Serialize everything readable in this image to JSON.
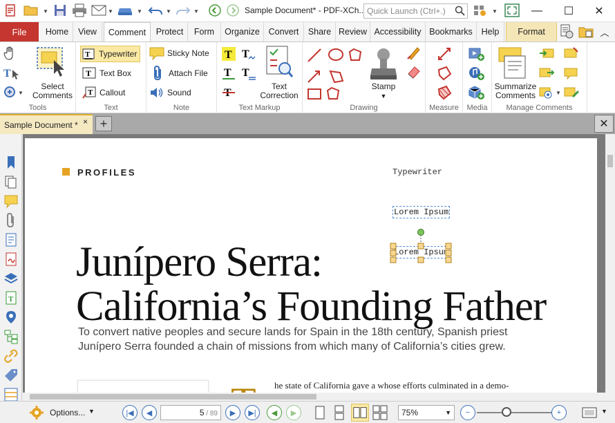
{
  "window": {
    "title": "Sample Document* - PDF-XCh..",
    "quick_launch_placeholder": "Quick Launch (Ctrl+.)",
    "minimize": "—",
    "maximize": "☐",
    "close": "✕"
  },
  "tabs": {
    "file": "File",
    "items": [
      "Home",
      "View",
      "Comment",
      "Protect",
      "Form",
      "Organize",
      "Convert",
      "Share",
      "Review",
      "Accessibility",
      "Bookmarks",
      "Help",
      "Format"
    ],
    "active": "Comment"
  },
  "ribbon": {
    "tools": {
      "label": "Tools",
      "select_comments": "Select\nComments"
    },
    "text": {
      "label": "Text",
      "typewriter": "Typewriter",
      "text_box": "Text Box",
      "callout": "Callout"
    },
    "note": {
      "label": "Note",
      "sticky_note": "Sticky Note",
      "attach_file": "Attach File",
      "sound": "Sound"
    },
    "text_markup": {
      "label": "Text Markup",
      "text_correction": "Text\nCorrection"
    },
    "drawing": {
      "label": "Drawing",
      "stamp": "Stamp"
    },
    "measure": {
      "label": "Measure"
    },
    "media": {
      "label": "Media"
    },
    "manage": {
      "label": "Manage Comments",
      "summarize": "Summarize\nComments"
    }
  },
  "doc_tab": {
    "name": "Sample Document *",
    "close": "×",
    "new": "+"
  },
  "document": {
    "section": "PROFILES",
    "typewriter_label": "Typewriter",
    "lorem1": "Lorem Ipsum",
    "lorem2": "Lorem Ipsum",
    "headline_line1": "Junípero Serra:",
    "headline_line2": "California’s Founding Father",
    "subhead": "To convert native peoples and secure lands for Spain in the 18th century, Spanish priest Junípero Serra founded a chain of missions from which many of California’s cities grew.",
    "dropcap": "T",
    "body_start": "he state of California gave a    whose efforts culminated in a demo-"
  },
  "statusbar": {
    "options": "Options...",
    "page_current": "5",
    "page_total": "89",
    "zoom": "75%"
  },
  "colors": {
    "file_tab": "#c4362f",
    "accent_gold": "#e6a323",
    "format_tab": "#f5e6b8",
    "selection_blue": "#5a8fd8"
  }
}
